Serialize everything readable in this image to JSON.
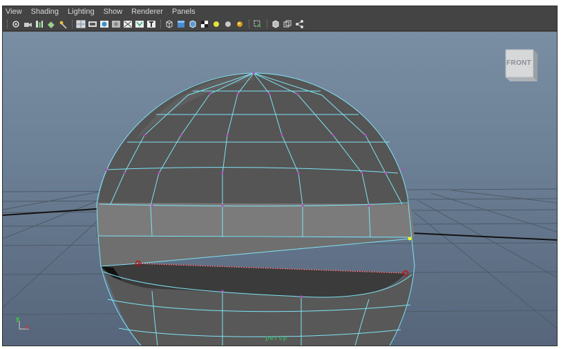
{
  "menu": {
    "items": [
      "View",
      "Shading",
      "Lighting",
      "Show",
      "Renderer",
      "Panels"
    ]
  },
  "toolbar": {
    "groups": [
      [
        "select-camera-icon",
        "lock-camera-icon",
        "camera-attributes-icon",
        "bookmark-icon",
        "image-plane-icon"
      ],
      [
        "grid-icon",
        "film-gate-icon",
        "resolution-gate-icon",
        "gate-mask-icon",
        "field-chart-icon",
        "safe-action-icon",
        "safe-title-icon"
      ],
      [
        "wireframe-icon",
        "smooth-shade-icon",
        "wireframe-on-shaded-icon",
        "textured-icon",
        "default-light-icon",
        "all-lights-icon",
        "shadows-icon"
      ],
      [
        "isolate-select-icon"
      ],
      [
        "xray-icon",
        "xray-joints-icon",
        "xray-components-icon"
      ]
    ]
  },
  "viewport": {
    "view_cube_label": "FRONT",
    "camera_name": "persp",
    "axis_y": "y",
    "axis_x": "x"
  },
  "colors": {
    "wire": "#7fe4f5",
    "vertex": "#c040c0",
    "edge_selected": "#d00000",
    "vertex_selected": "#ffff00"
  }
}
